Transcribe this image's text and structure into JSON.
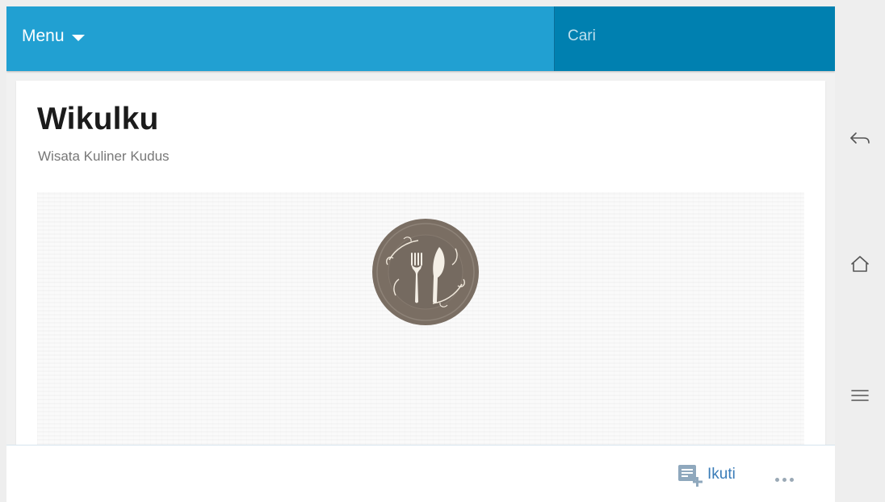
{
  "header": {
    "menu_label": "Menu",
    "search_placeholder": "Cari"
  },
  "blog": {
    "title": "Wikulku",
    "description": "Wisata Kuliner Kudus",
    "logo_icon": "plate-fork-knife-logo"
  },
  "footer": {
    "follow_label": "Ikuti",
    "follow_icon": "add-to-reading-list-icon",
    "more_icon": "more-horizontal-icon"
  },
  "system_nav": {
    "back_icon": "back-icon",
    "home_icon": "home-icon",
    "menu_icon": "hamburger-menu-icon"
  },
  "colors": {
    "header_blue": "#21a0d2",
    "search_blue": "#0080b0",
    "link_blue": "#3a7cb8",
    "logo_brown": "#7a6e63"
  }
}
